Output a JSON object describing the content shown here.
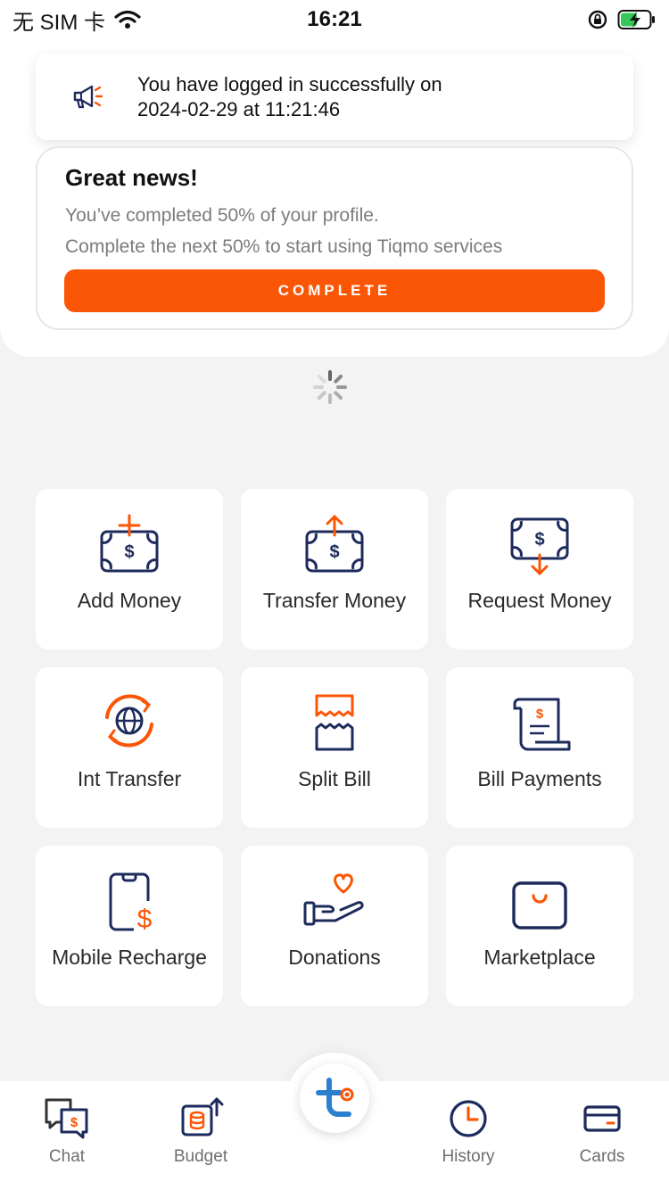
{
  "status_bar": {
    "carrier": "无 SIM 卡",
    "time": "16:21"
  },
  "notification": {
    "line1": "You have logged in successfully on",
    "line2": "2024-02-29 at 11:21:46",
    "icon": "megaphone-icon"
  },
  "profile_card": {
    "title": "Great news!",
    "line1": "You’ve completed 50% of your profile.",
    "line2": "Complete the next 50% to start using Tiqmo services",
    "progress_percent": 50,
    "button_label": "COMPLETE"
  },
  "services": [
    {
      "label": "Add Money",
      "icon": "add-money-icon"
    },
    {
      "label": "Transfer Money",
      "icon": "transfer-money-icon"
    },
    {
      "label": "Request Money",
      "icon": "request-money-icon"
    },
    {
      "label": "Int Transfer",
      "icon": "globe-transfer-icon"
    },
    {
      "label": "Split Bill",
      "icon": "split-bill-icon"
    },
    {
      "label": "Bill Payments",
      "icon": "bill-payments-icon"
    },
    {
      "label": "Mobile Recharge",
      "icon": "mobile-recharge-icon"
    },
    {
      "label": "Donations",
      "icon": "donations-icon"
    },
    {
      "label": "Marketplace",
      "icon": "shopping-bag-icon"
    }
  ],
  "bottom_nav": {
    "chat": "Chat",
    "budget": "Budget",
    "history": "History",
    "cards": "Cards",
    "center_icon": "tiqmo-logo-icon"
  },
  "colors": {
    "accent": "#fb5506",
    "navy": "#1d2b5c",
    "background": "#f3f3f4"
  }
}
